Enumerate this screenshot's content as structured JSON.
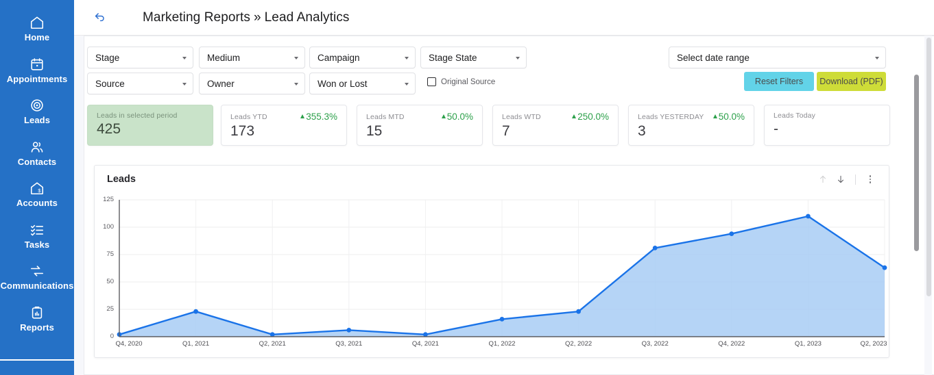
{
  "sidebar": {
    "brand_color": "#2571c6",
    "items": [
      {
        "label": "Home",
        "icon": "home-icon"
      },
      {
        "label": "Appointments",
        "icon": "calendar-icon"
      },
      {
        "label": "Leads",
        "icon": "target-icon"
      },
      {
        "label": "Contacts",
        "icon": "people-icon"
      },
      {
        "label": "Accounts",
        "icon": "house-dollar-icon"
      },
      {
        "label": "Tasks",
        "icon": "checklist-icon"
      },
      {
        "label": "Communications",
        "icon": "arrows-exchange-icon"
      },
      {
        "label": "Reports",
        "icon": "clipboard-chart-icon"
      }
    ]
  },
  "header": {
    "back_icon": "back-arrow-icon",
    "breadcrumb_parent": "Marketing Reports",
    "breadcrumb_separator": "»",
    "breadcrumb_current": "Lead Analytics"
  },
  "filters": {
    "row1": [
      {
        "label": "Stage"
      },
      {
        "label": "Medium"
      },
      {
        "label": "Campaign"
      },
      {
        "label": "Stage State"
      }
    ],
    "row2": [
      {
        "label": "Source"
      },
      {
        "label": "Owner"
      },
      {
        "label": "Won or Lost"
      }
    ],
    "original_source": {
      "label": "Original Source",
      "checked": false
    },
    "date_range": {
      "label": "Select date range"
    },
    "reset_button": {
      "label": "Reset Filters",
      "color": "#62d3e8"
    },
    "download_button": {
      "label": "Download (PDF)",
      "color": "#cedc38"
    }
  },
  "kpis": [
    {
      "label": "Leads in selected period",
      "value": "425",
      "delta": "",
      "highlight": true
    },
    {
      "label": "Leads YTD",
      "value": "173",
      "delta": "355.3%",
      "highlight": false
    },
    {
      "label": "Leads MTD",
      "value": "15",
      "delta": "50.0%",
      "highlight": false
    },
    {
      "label": "Leads WTD",
      "value": "7",
      "delta": "250.0%",
      "highlight": false
    },
    {
      "label": "Leads YESTERDAY",
      "value": "3",
      "delta": "50.0%",
      "highlight": false
    },
    {
      "label": "Leads Today",
      "value": "-",
      "delta": "",
      "highlight": false
    }
  ],
  "chart_card": {
    "title": "Leads",
    "tools": [
      {
        "name": "move-up-icon",
        "state": "disabled"
      },
      {
        "name": "move-down-icon",
        "state": "enabled"
      },
      {
        "name": "more-options-icon",
        "state": "enabled"
      }
    ]
  },
  "chart_data": {
    "type": "area",
    "title": "Leads",
    "xlabel": "",
    "ylabel": "",
    "grid": true,
    "legend": "none",
    "line_color": "#1a73e8",
    "fill_color": "#a8cdf5",
    "ylim": [
      0,
      125
    ],
    "yticks": [
      0,
      25,
      50,
      75,
      100,
      125
    ],
    "categories": [
      "Q4, 2020",
      "Q1, 2021",
      "Q2, 2021",
      "Q3, 2021",
      "Q4, 2021",
      "Q1, 2022",
      "Q2, 2022",
      "Q3, 2022",
      "Q4, 2022",
      "Q1, 2023",
      "Q2, 2023"
    ],
    "series": [
      {
        "name": "Leads",
        "values": [
          2,
          23,
          2,
          6,
          2,
          16,
          23,
          81,
          94,
          110,
          63
        ]
      }
    ]
  }
}
